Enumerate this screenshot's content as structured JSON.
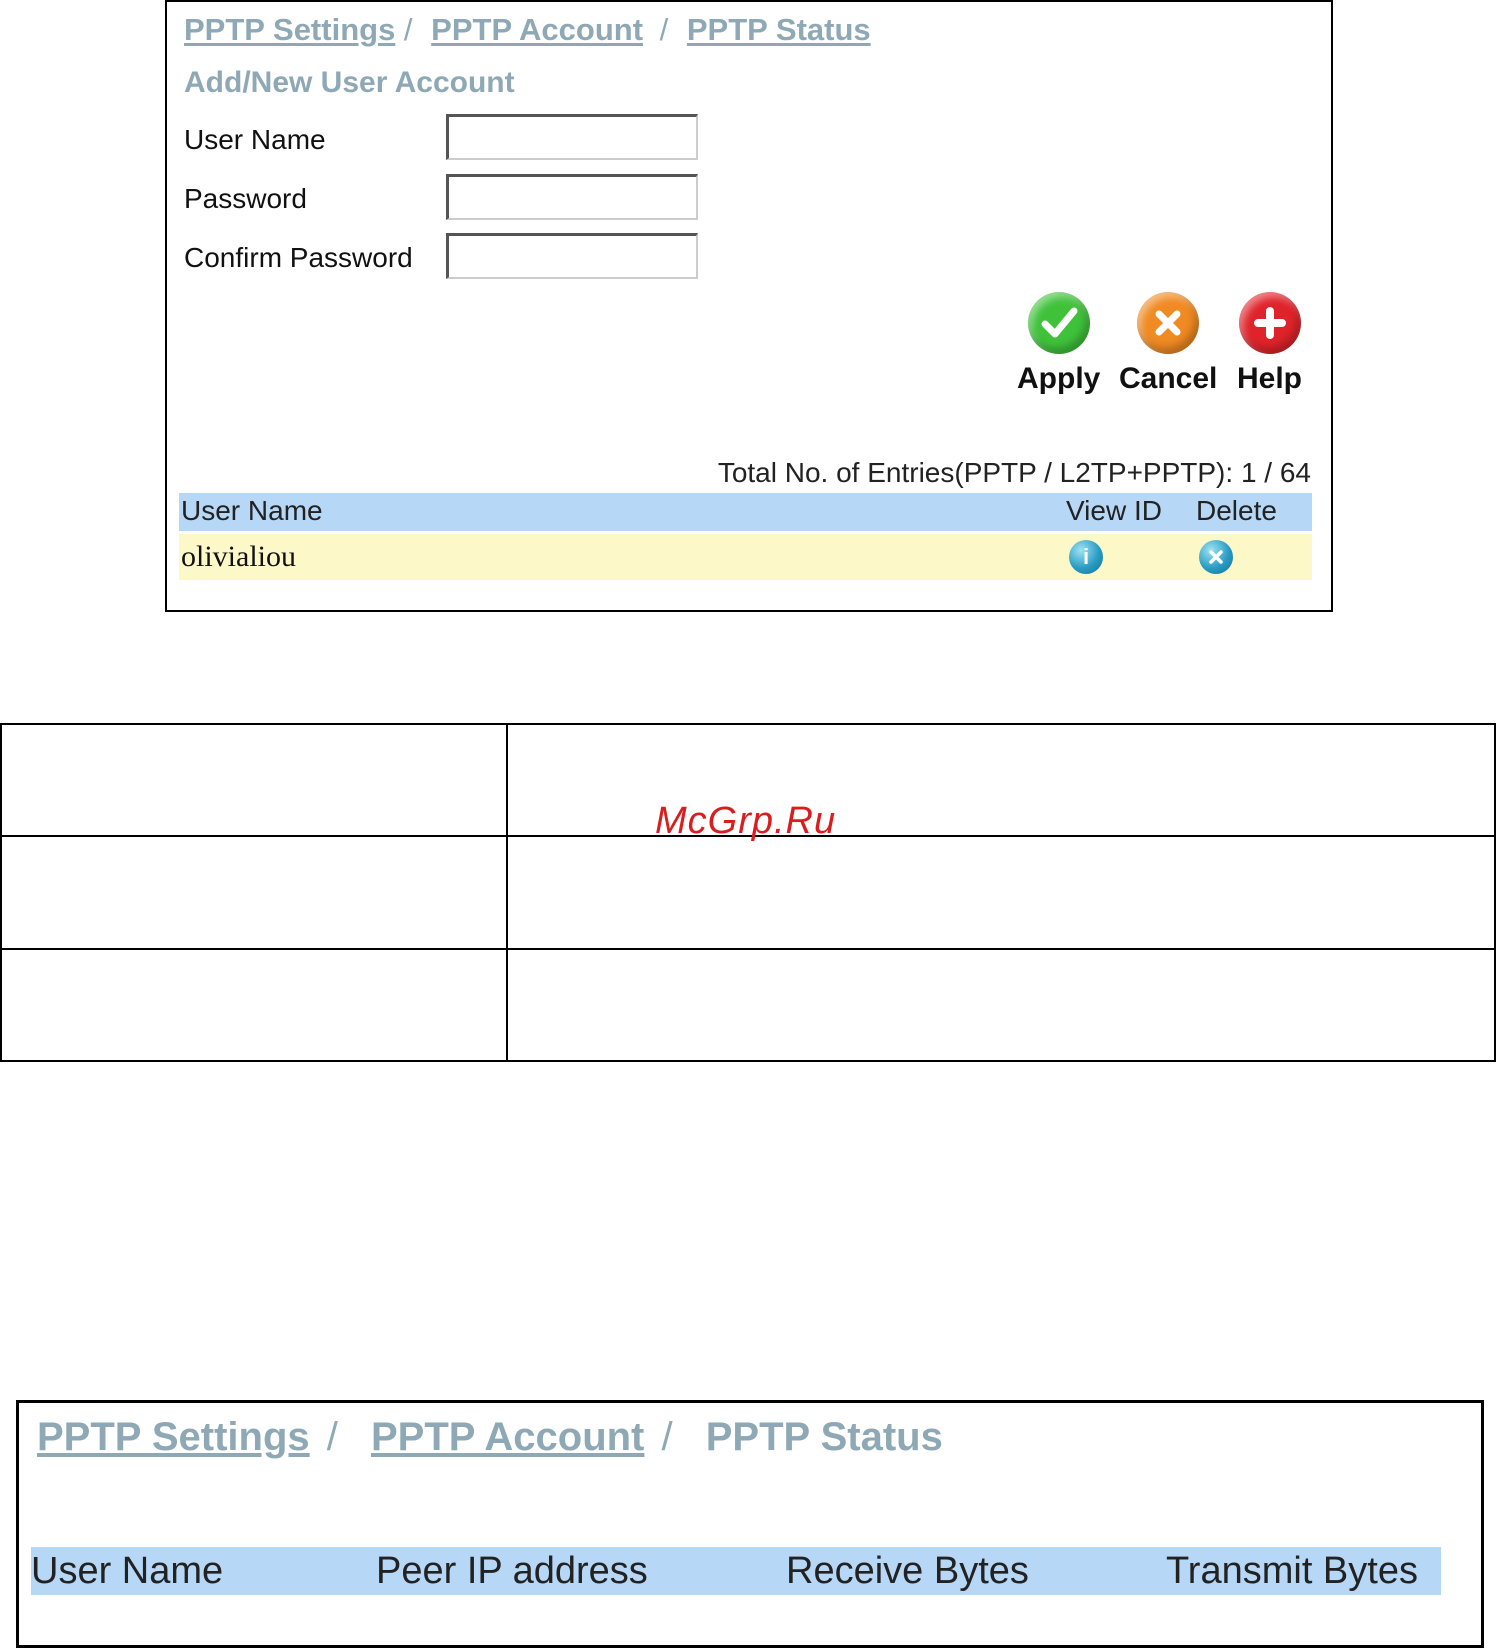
{
  "pptp_account_panel": {
    "breadcrumb": [
      {
        "label": "PPTP Settings",
        "sep": " / "
      },
      {
        "label": "PPTP Account",
        "sep": " / "
      },
      {
        "label": "PPTP Status",
        "sep": ""
      }
    ],
    "heading": "Add/New User Account",
    "fields": {
      "user_name": {
        "label": "User Name",
        "value": ""
      },
      "password": {
        "label": "Password",
        "value": ""
      },
      "confirm_password": {
        "label": "Confirm Password",
        "value": ""
      }
    },
    "actions": {
      "apply": {
        "label": "Apply",
        "icon": "checkmark-icon",
        "color": "#3fc23a"
      },
      "cancel": {
        "label": "Cancel",
        "icon": "x-icon",
        "color": "#f08a22"
      },
      "help": {
        "label": "Help",
        "icon": "plus-icon",
        "color": "#e0232a"
      }
    },
    "total_entries": "Total No. of Entries(PPTP / L2TP+PPTP): 1 / 64",
    "table": {
      "columns": [
        "User Name",
        "View ID",
        "Delete"
      ],
      "rows": [
        {
          "user_name": "olivialiou",
          "view_icon": "info-icon",
          "delete_icon": "delete-icon"
        }
      ],
      "header_color": "#b6d7f6",
      "row_color": "#fdf8c8"
    }
  },
  "watermark": "McGrp.Ru",
  "pptp_status_panel": {
    "breadcrumb": [
      {
        "label": "PPTP Settings",
        "sep": " / "
      },
      {
        "label": "PPTP Account",
        "sep": " / "
      },
      {
        "label": "PPTP Status",
        "sep": ""
      }
    ],
    "table": {
      "columns": [
        "User Name",
        "Peer IP address",
        "Receive Bytes",
        "Transmit Bytes"
      ]
    }
  },
  "colors": {
    "link": "#8ea9b5",
    "table_header": "#b6d7f6"
  }
}
